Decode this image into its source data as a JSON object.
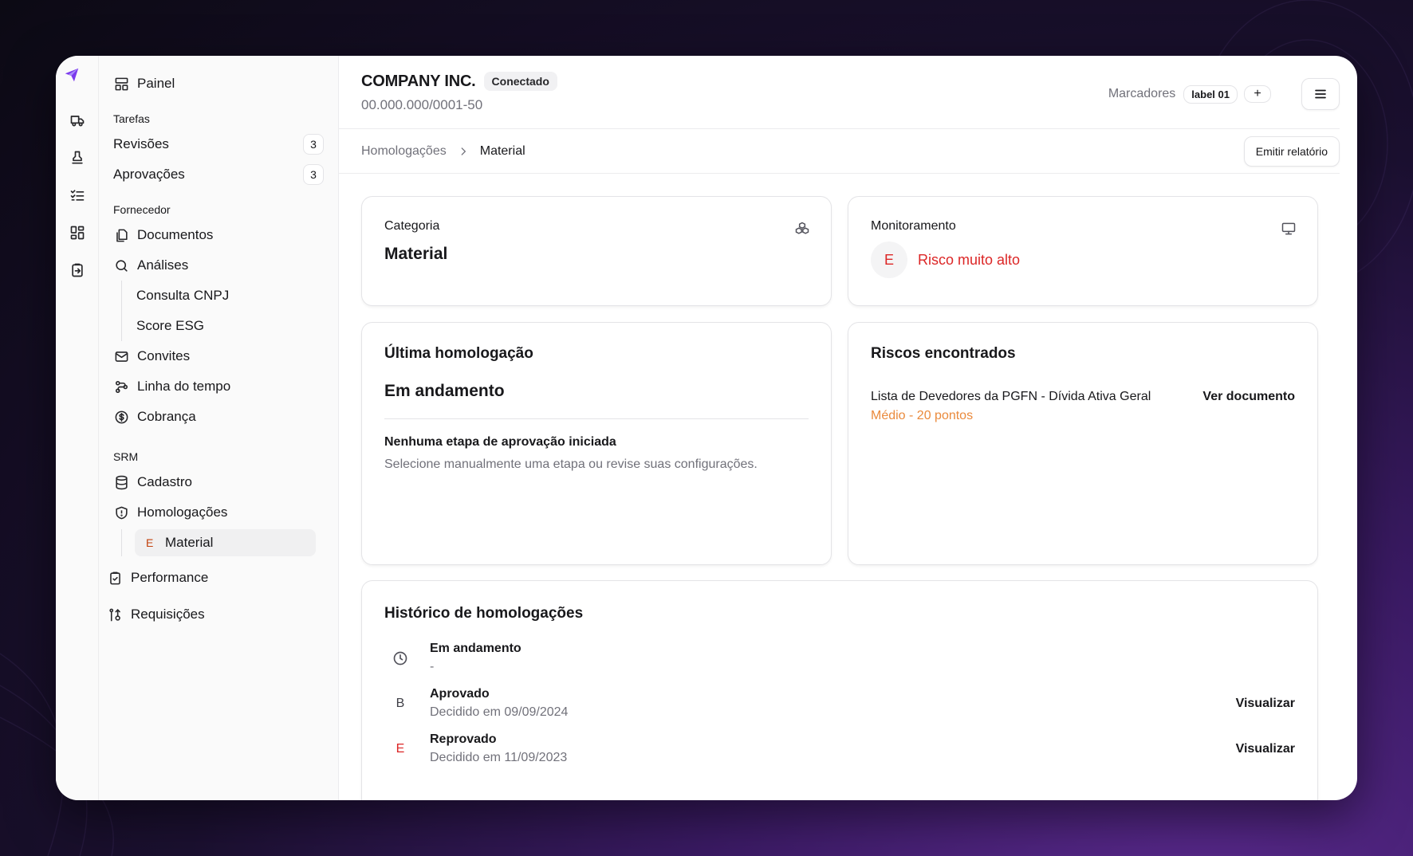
{
  "header": {
    "company_name": "COMPANY INC.",
    "status": "Conectado",
    "cnpj": "00.000.000/0001-50",
    "markers_label": "Marcadores",
    "marker_chip": "label 01",
    "add_marker": "+"
  },
  "breadcrumb": {
    "parent": "Homologações",
    "current": "Material",
    "report_button": "Emitir relatório"
  },
  "sidebar": {
    "painel": "Painel",
    "tasks_section": "Tarefas",
    "revisoes": "Revisões",
    "revisoes_count": "3",
    "aprovacoes": "Aprovações",
    "aprovacoes_count": "3",
    "supplier_section": "Fornecedor",
    "documentos": "Documentos",
    "analises": "Análises",
    "consulta_cnpj": "Consulta CNPJ",
    "score_esg": "Score ESG",
    "convites": "Convites",
    "linha_tempo": "Linha do tempo",
    "cobranca": "Cobrança",
    "srm_section": "SRM",
    "cadastro": "Cadastro",
    "homologacoes": "Homologações",
    "material_grade": "E",
    "material": "Material",
    "performance": "Performance",
    "requisicoes": "Requisições"
  },
  "cards": {
    "category": {
      "label": "Categoria",
      "value": "Material"
    },
    "monitoring": {
      "label": "Monitoramento",
      "grade": "E",
      "risk": "Risco muito alto"
    },
    "last_approval": {
      "title": "Última homologação",
      "status": "Em andamento",
      "subtitle": "Nenhuma etapa de aprovação iniciada",
      "description": "Selecione manualmente uma etapa ou revise suas configurações."
    },
    "risks": {
      "title": "Riscos encontrados",
      "item_name": "Lista de Devedores da PGFN - Dívida Ativa Geral",
      "item_score": "Médio - 20 pontos",
      "item_action": "Ver documento"
    },
    "history": {
      "title": "Histórico de homologações",
      "rows": [
        {
          "badge": "",
          "title": "Em andamento",
          "sub": "-",
          "action": ""
        },
        {
          "badge": "B",
          "title": "Aprovado",
          "sub": "Decidido em 09/09/2024",
          "action": "Visualizar"
        },
        {
          "badge": "E",
          "title": "Reprovado",
          "sub": "Decidido em 11/09/2023",
          "action": "Visualizar"
        }
      ]
    }
  },
  "colors": {
    "brand": "#7c3aed",
    "danger": "#dc2626",
    "warning": "#ea8a3c"
  },
  "icons": [
    "send-logo-icon",
    "truck-icon",
    "stamp-icon",
    "checklist-icon",
    "grid-icon",
    "clipboard-icon",
    "layout-icon",
    "files-icon",
    "search-icon",
    "mail-icon",
    "timeline-icon",
    "dollar-icon",
    "database-icon",
    "shield-icon",
    "clipboard-check-icon",
    "requisition-icon",
    "blocks-icon",
    "monitor-icon",
    "menu-icon",
    "chevron-right-icon",
    "clock-icon"
  ]
}
